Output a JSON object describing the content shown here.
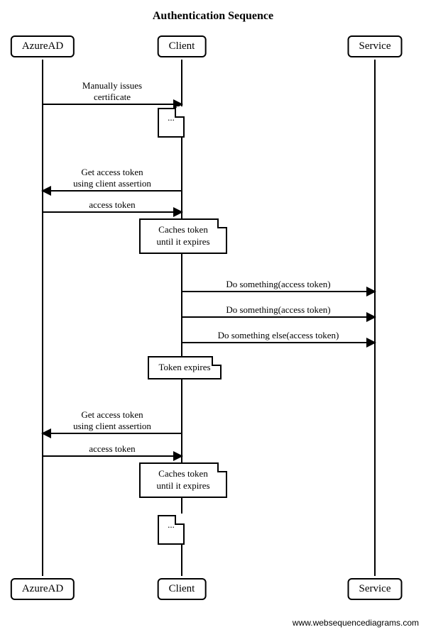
{
  "title": "Authentication Sequence",
  "participants": {
    "a": "AzureAD",
    "b": "Client",
    "c": "Service"
  },
  "messages": {
    "m1": "Manually issues\ncertificate",
    "m2": "Get access token\nusing client assertion",
    "m3": "access token",
    "m4": "Do something(access token)",
    "m5": "Do something(access token)",
    "m6": "Do something else(access token)",
    "m7": "Get access token\nusing client assertion",
    "m8": "access token"
  },
  "notes": {
    "n1": "...",
    "n2": "Caches token\nuntil it expires",
    "n3": "Token expires",
    "n4": "Caches token\nuntil it expires",
    "n5": "..."
  },
  "watermark": "www.websequencediagrams.com"
}
